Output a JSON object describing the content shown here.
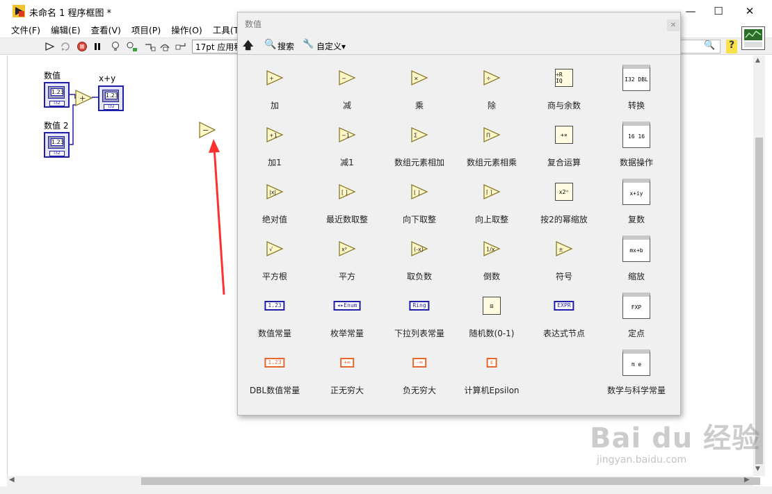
{
  "window": {
    "title": "未命名 1 程序框图 *",
    "minimize_glyph": "—",
    "maximize_glyph": "☐",
    "close_glyph": "✕"
  },
  "menu": [
    {
      "label": "文件(F)"
    },
    {
      "label": "编辑(E)"
    },
    {
      "label": "查看(V)"
    },
    {
      "label": "项目(P)"
    },
    {
      "label": "操作(O)"
    },
    {
      "label": "工具(T)"
    }
  ],
  "toolbar": {
    "font": "17pt 应用程"
  },
  "diagram": {
    "control1_label": "数值",
    "control2_label": "数值 2",
    "indicator_label": "x+y",
    "numeric_display": "1.23",
    "type_tag": "I32",
    "add_glyph": "+",
    "subtract_glyph": "−"
  },
  "palette": {
    "title": "数值",
    "search_label": "搜索",
    "custom_label": "自定义▾",
    "items": [
      {
        "label": "加",
        "glyph": "+"
      },
      {
        "label": "减",
        "glyph": "−"
      },
      {
        "label": "乘",
        "glyph": "×"
      },
      {
        "label": "除",
        "glyph": "÷"
      },
      {
        "label": "商与余数",
        "glyph": "÷R IQ"
      },
      {
        "label": "转换",
        "glyph": "I32 DBL"
      },
      {
        "label": "加1",
        "glyph": "+1"
      },
      {
        "label": "减1",
        "glyph": "−1"
      },
      {
        "label": "数组元素相加",
        "glyph": "Σ"
      },
      {
        "label": "数组元素相乘",
        "glyph": "Π"
      },
      {
        "label": "复合运算",
        "glyph": "+×"
      },
      {
        "label": "数据操作",
        "glyph": "16 16"
      },
      {
        "label": "绝对值",
        "glyph": "|x|"
      },
      {
        "label": "最近数取整",
        "glyph": "[ ]"
      },
      {
        "label": "向下取整",
        "glyph": "⌊ ⌋"
      },
      {
        "label": "向上取整",
        "glyph": "⌈ ⌉"
      },
      {
        "label": "按2的幂缩放",
        "glyph": "x2ⁿ"
      },
      {
        "label": "复数",
        "glyph": "x+iy"
      },
      {
        "label": "平方根",
        "glyph": "√"
      },
      {
        "label": "平方",
        "glyph": "x²"
      },
      {
        "label": "取负数",
        "glyph": "(-x)"
      },
      {
        "label": "倒数",
        "glyph": "1/x"
      },
      {
        "label": "符号",
        "glyph": "±"
      },
      {
        "label": "缩放",
        "glyph": "mx+b"
      },
      {
        "label": "数值常量",
        "glyph": "1.23"
      },
      {
        "label": "枚举常量",
        "glyph": "◂▸Enum"
      },
      {
        "label": "下拉列表常量",
        "glyph": "Ring"
      },
      {
        "label": "随机数(0-1)",
        "glyph": "⚄"
      },
      {
        "label": "表达式节点",
        "glyph": "EXPR"
      },
      {
        "label": "定点",
        "glyph": "FXP"
      },
      {
        "label": "DBL数值常量",
        "glyph": "1.23"
      },
      {
        "label": "正无穷大",
        "glyph": "+∞"
      },
      {
        "label": "负无穷大",
        "glyph": "-∞"
      },
      {
        "label": "计算机Epsilon",
        "glyph": "ε"
      },
      {
        "label": "数学与科学常量",
        "glyph": "π e"
      }
    ]
  },
  "watermark": {
    "text": "Bai du 经验",
    "url": "jingyan.baidu.com"
  },
  "colors": {
    "wire_blue": "#1e1ea8",
    "primitive_fill": "#fff7c8",
    "primitive_stroke": "#8a7a2a",
    "constant_orange": "#e8662a",
    "red_arrow": "#ff3030"
  }
}
